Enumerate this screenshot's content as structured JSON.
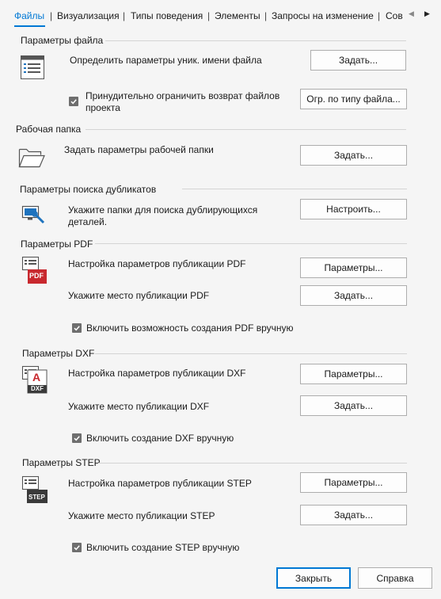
{
  "tabs": [
    {
      "label": "Файлы",
      "active": true
    },
    {
      "label": "Визуализация"
    },
    {
      "label": "Типы поведения"
    },
    {
      "label": "Элементы"
    },
    {
      "label": "Запросы на изменение"
    },
    {
      "label": "Сов"
    }
  ],
  "file_params": {
    "header": "Параметры файла",
    "unique_name_label": "Определить параметры уник. имени файла",
    "unique_name_button": "Задать...",
    "restrict_checkbox_label": "Принудительно ограничить возврат файлов проекта",
    "restrict_checked": true,
    "restrict_button": "Огр. по типу файла..."
  },
  "work_folder": {
    "header": "Рабочая папка",
    "label": "Задать параметры рабочей папки",
    "button": "Задать..."
  },
  "duplicates": {
    "header": "Параметры поиска дубликатов",
    "label": "Укажите папки для поиска дублирующихся деталей.",
    "button": "Настроить..."
  },
  "pdf": {
    "header": "Параметры PDF",
    "icon_text": "PDF",
    "publish_label": "Настройка параметров публикации PDF",
    "publish_button": "Параметры...",
    "location_label": "Укажите место публикации PDF",
    "location_button": "Задать...",
    "manual_label": "Включить возможность создания PDF вручную",
    "manual_checked": true
  },
  "dxf": {
    "header": "Параметры DXF",
    "icon_text": "DXF",
    "icon_letter": "A",
    "publish_label": "Настройка параметров публикации DXF",
    "publish_button": "Параметры...",
    "location_label": "Укажите место публикации DXF",
    "location_button": "Задать...",
    "manual_label": "Включить создание DXF вручную",
    "manual_checked": true
  },
  "step": {
    "header": "Параметры STEP",
    "icon_text": "STEP",
    "publish_label": "Настройка параметров публикации STEP",
    "publish_button": "Параметры...",
    "location_label": "Укажите место публикации STEP",
    "location_button": "Задать...",
    "manual_label": "Включить создание STEP вручную",
    "manual_checked": true
  },
  "footer": {
    "close_button": "Закрыть",
    "help_button": "Справка"
  },
  "colors": {
    "accent": "#0078d4",
    "pdf_red": "#c8282e",
    "icon_blue": "#1e73be"
  }
}
